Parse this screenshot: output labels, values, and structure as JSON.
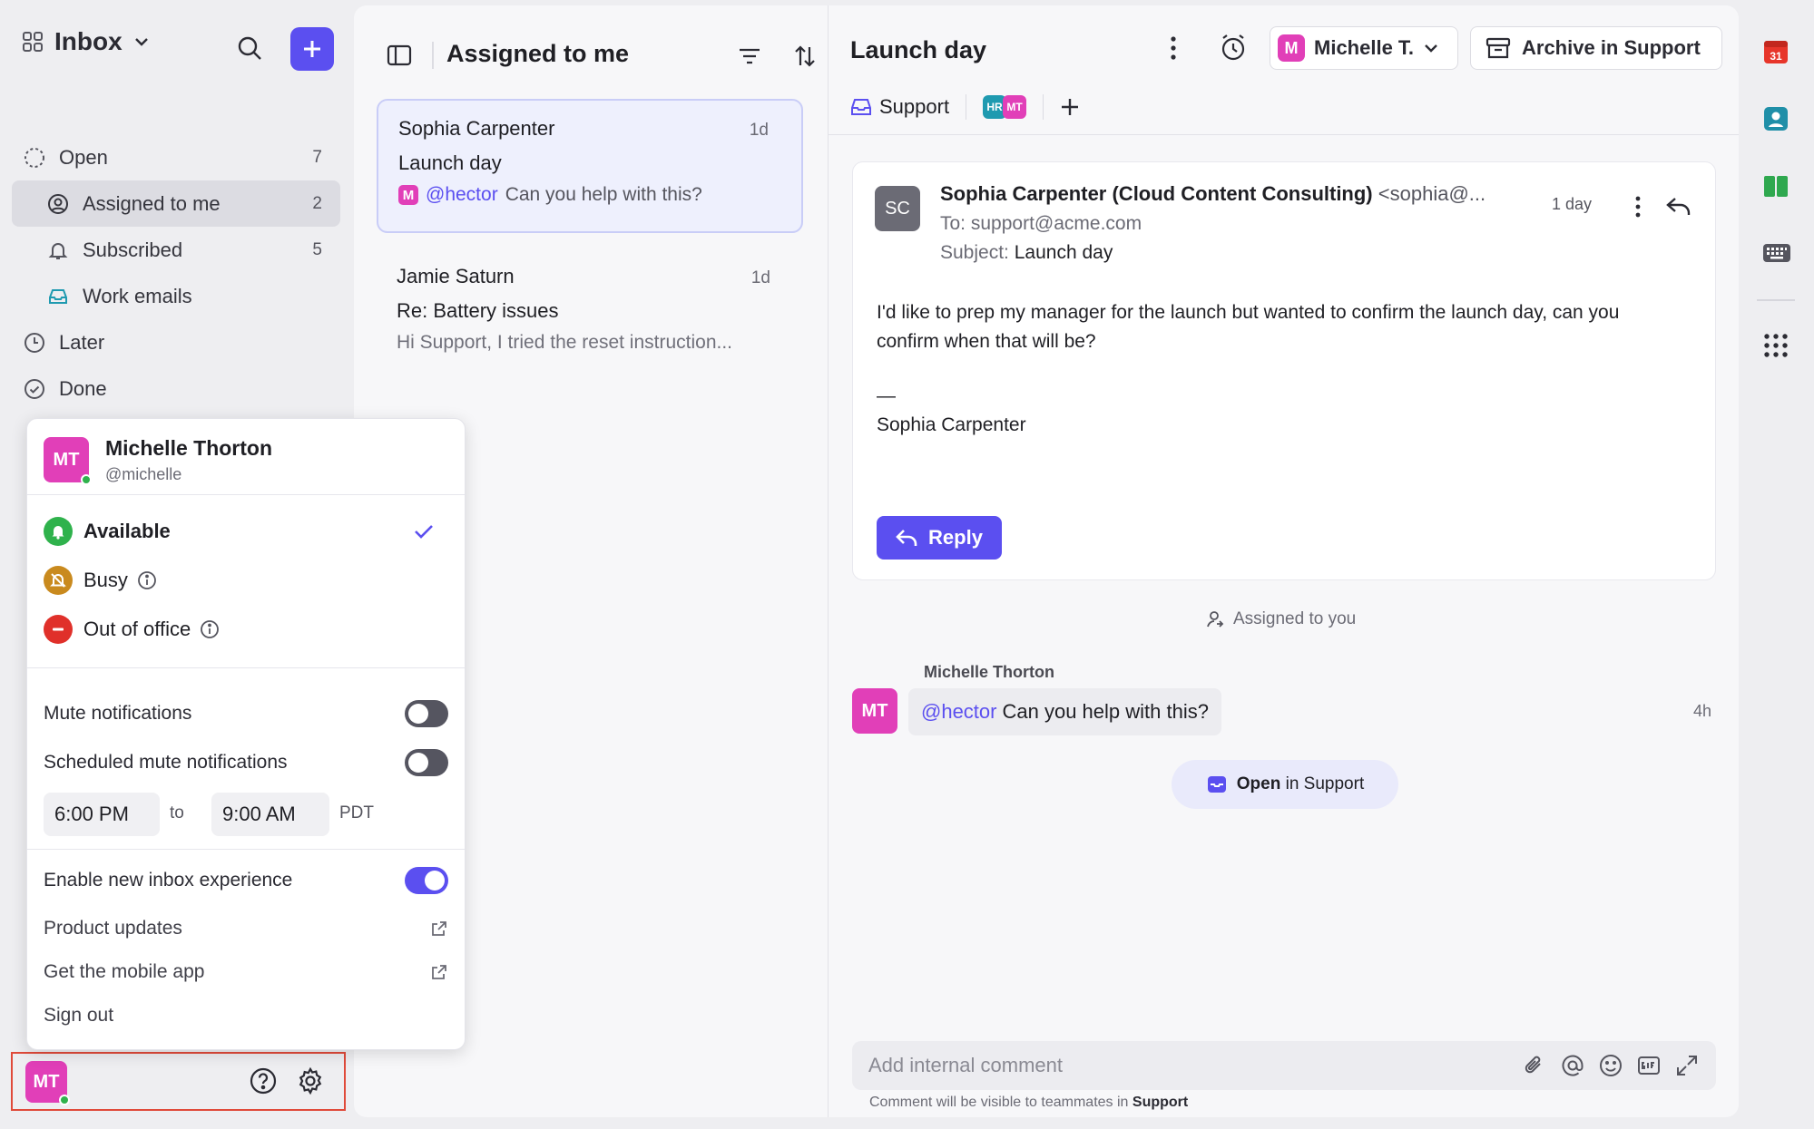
{
  "sidebar": {
    "inbox_label": "Inbox",
    "nav": [
      {
        "label": "Open",
        "count": "7"
      },
      {
        "label": "Assigned to me",
        "count": "2"
      },
      {
        "label": "Subscribed",
        "count": "5"
      },
      {
        "label": "Work emails",
        "count": ""
      },
      {
        "label": "Later",
        "count": ""
      },
      {
        "label": "Done",
        "count": ""
      }
    ],
    "user_initials": "MT"
  },
  "status_menu": {
    "name": "Michelle Thorton",
    "handle": "@michelle",
    "initials": "MT",
    "options": [
      {
        "label": "Available",
        "selected": true,
        "color": "#2fb24c"
      },
      {
        "label": "Busy",
        "selected": false,
        "color": "#c98a1e"
      },
      {
        "label": "Out of office",
        "selected": false,
        "color": "#e0302a"
      }
    ],
    "mute_label": "Mute notifications",
    "mute_on": false,
    "scheduled_label": "Scheduled mute notifications",
    "scheduled_on": false,
    "from_time": "6:00 PM",
    "to_word": "to",
    "to_time": "9:00 AM",
    "timezone": "PDT",
    "new_inbox_label": "Enable new inbox experience",
    "new_inbox_on": true,
    "product_updates": "Product updates",
    "mobile_app": "Get the mobile app",
    "sign_out": "Sign out"
  },
  "list": {
    "title": "Assigned to me",
    "conversations": [
      {
        "name": "Sophia Carpenter",
        "time": "1d",
        "subject": "Launch day",
        "badge": "M",
        "mention": "@hector",
        "preview": "Can you help with this?"
      },
      {
        "name": "Jamie Saturn",
        "time": "1d",
        "subject": "Re: Battery issues",
        "preview": "Hi Support, I tried the reset instruction..."
      }
    ]
  },
  "detail": {
    "title": "Launch day",
    "assignee_badge": "M",
    "assignee": "Michelle T.",
    "archive_label": "Archive in Support",
    "inbox_tag": "Support",
    "participants": [
      "HR",
      "MT"
    ],
    "email": {
      "avatar": "SC",
      "sender_name": "Sophia Carpenter (Cloud Content Consulting)",
      "sender_addr": "<sophia@...",
      "time": "1 day",
      "to_label": "To:",
      "to": "support@acme.com",
      "subject_label": "Subject:",
      "subject": "Launch day",
      "body": "I'd like to prep my manager for the launch but wanted to confirm the launch day, can you confirm when that will be?",
      "dash": "—",
      "signature": "Sophia Carpenter",
      "reply_label": "Reply"
    },
    "event": "Assigned to you",
    "comment": {
      "author": "Michelle Thorton",
      "initials": "MT",
      "mention": "@hector",
      "text": "Can you help with this?",
      "time": "4h"
    },
    "open_in": {
      "bold": "Open",
      "rest": "in Support"
    },
    "input_placeholder": "Add internal comment",
    "hint_prefix": "Comment will be visible to teammates in",
    "hint_inbox": "Support"
  },
  "rail": {
    "calendar_day": "31"
  },
  "colors": {
    "accent": "#5b4ff0",
    "avatar_pink": "#e13fb8",
    "highlight_border": "#e04a3a"
  }
}
